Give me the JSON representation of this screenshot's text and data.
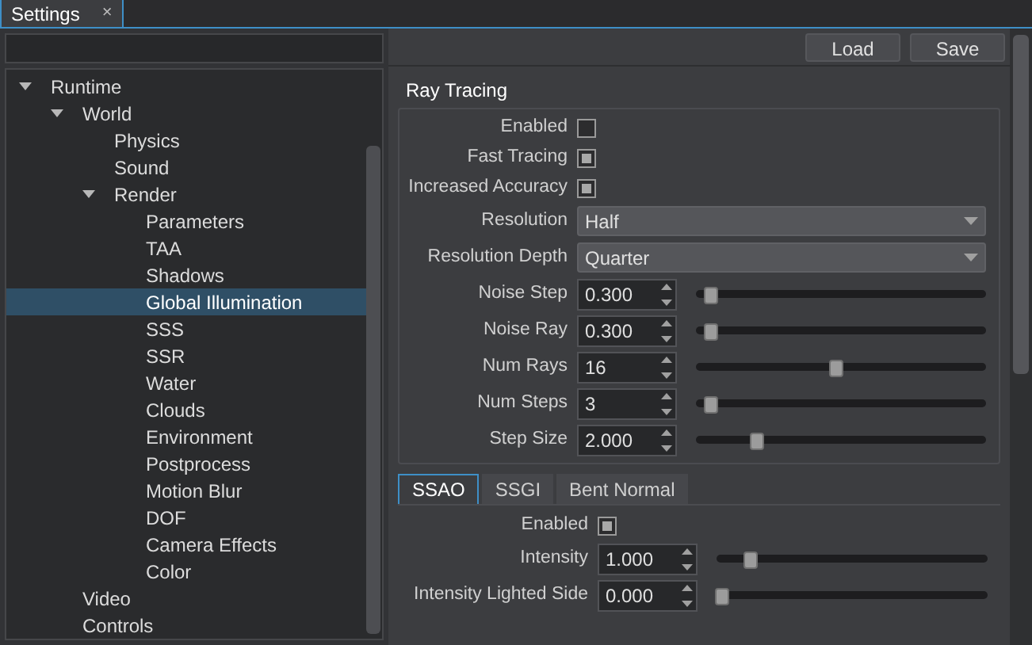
{
  "window": {
    "tab": {
      "title": "Settings",
      "close": "×"
    }
  },
  "tree": [
    {
      "label": "Runtime",
      "expanded": true,
      "selected": false,
      "children": [
        {
          "label": "World",
          "expanded": true,
          "selected": false,
          "children": [
            {
              "label": "Physics",
              "selected": false
            },
            {
              "label": "Sound",
              "selected": false
            },
            {
              "label": "Render",
              "expanded": true,
              "selected": false,
              "children": [
                {
                  "label": "Parameters",
                  "selected": false
                },
                {
                  "label": "TAA",
                  "selected": false
                },
                {
                  "label": "Shadows",
                  "selected": false
                },
                {
                  "label": "Global Illumination",
                  "selected": true
                },
                {
                  "label": "SSS",
                  "selected": false
                },
                {
                  "label": "SSR",
                  "selected": false
                },
                {
                  "label": "Water",
                  "selected": false
                },
                {
                  "label": "Clouds",
                  "selected": false
                },
                {
                  "label": "Environment",
                  "selected": false
                },
                {
                  "label": "Postprocess",
                  "selected": false
                },
                {
                  "label": "Motion Blur",
                  "selected": false
                },
                {
                  "label": "DOF",
                  "selected": false
                },
                {
                  "label": "Camera Effects",
                  "selected": false
                },
                {
                  "label": "Color",
                  "selected": false
                }
              ]
            }
          ]
        },
        {
          "label": "Video",
          "selected": false
        },
        {
          "label": "Controls",
          "selected": false
        }
      ]
    }
  ],
  "toolbar": {
    "buttons": [
      "Load",
      "Save"
    ]
  },
  "ray_tracing": {
    "title": "Ray Tracing",
    "rows": [
      {
        "kind": "checkbox",
        "label": "Enabled",
        "checked": false
      },
      {
        "kind": "checkbox",
        "label": "Fast Tracing",
        "checked": true
      },
      {
        "kind": "checkbox",
        "label": "Increased Accuracy",
        "checked": true
      },
      {
        "kind": "combo",
        "label": "Resolution",
        "value": "Half"
      },
      {
        "kind": "combo",
        "label": "Resolution Depth",
        "value": "Quarter"
      },
      {
        "kind": "spin",
        "label": "Noise Step",
        "value": "0.300",
        "level": 0.05
      },
      {
        "kind": "spin",
        "label": "Noise Ray",
        "value": "0.300",
        "level": 0.05
      },
      {
        "kind": "spin",
        "label": "Num Rays",
        "value": "16",
        "level": 0.48
      },
      {
        "kind": "spin",
        "label": "Num Steps",
        "value": "3",
        "level": 0.05
      },
      {
        "kind": "spin",
        "label": "Step Size",
        "value": "2.000",
        "level": 0.21
      }
    ]
  },
  "sub_tabs": [
    {
      "label": "SSAO",
      "selected": true
    },
    {
      "label": "SSGI",
      "selected": false
    },
    {
      "label": "Bent Normal",
      "selected": false
    }
  ],
  "ssao": {
    "rows": [
      {
        "kind": "checkbox",
        "label": "Enabled",
        "checked": true
      },
      {
        "kind": "spin",
        "label": "Intensity",
        "value": "1.000",
        "level": 0.12
      },
      {
        "kind": "spin",
        "label": "Intensity Lighted Side",
        "value": "0.000",
        "level": 0.02
      }
    ]
  }
}
